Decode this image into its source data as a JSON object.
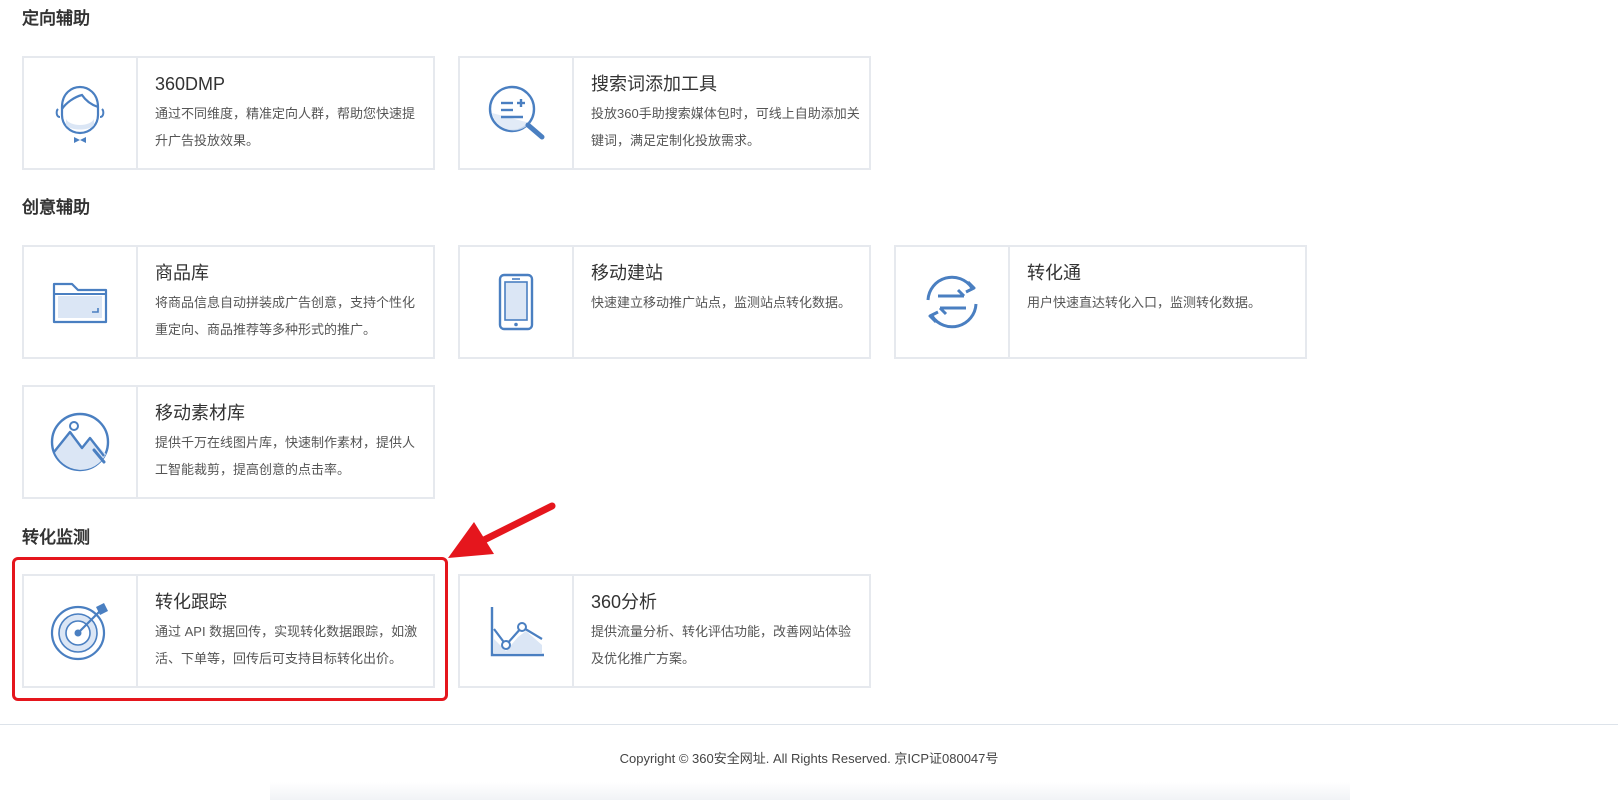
{
  "sections": {
    "targeting": {
      "title": "定向辅助",
      "cards": [
        {
          "title": "360DMP",
          "desc": "通过不同维度，精准定向人群，帮助您快速提升广告投放效果。",
          "icon": "avatar-icon"
        },
        {
          "title": "搜索词添加工具",
          "desc": "投放360手助搜索媒体包时，可线上自助添加关键词，满足定制化投放需求。",
          "icon": "search-list-icon"
        }
      ]
    },
    "creative": {
      "title": "创意辅助",
      "cards": [
        {
          "title": "商品库",
          "desc": "将商品信息自动拼装成广告创意，支持个性化重定向、商品推荐等多种形式的推广。",
          "icon": "folder-icon"
        },
        {
          "title": "移动建站",
          "desc": "快速建立移动推广站点，监测站点转化数据。",
          "icon": "tablet-icon"
        },
        {
          "title": "转化通",
          "desc": "用户快速直达转化入口，监测转化数据。",
          "icon": "exchange-icon"
        },
        {
          "title": "移动素材库",
          "desc": "提供千万在线图片库，快速制作素材，提供人工智能裁剪，提高创意的点击率。",
          "icon": "image-library-icon"
        }
      ]
    },
    "conversion": {
      "title": "转化监测",
      "cards": [
        {
          "title": "转化跟踪",
          "desc": "通过 API 数据回传，实现转化数据跟踪，如激活、下单等，回传后可支持目标转化出价。",
          "icon": "target-icon"
        },
        {
          "title": "360分析",
          "desc": "提供流量分析、转化评估功能，改善网站体验及优化推广方案。",
          "icon": "line-chart-icon"
        }
      ]
    }
  },
  "footer": {
    "copyright": "Copyright © 360安全网址. All Rights Reserved. 京ICP证080047号"
  },
  "colors": {
    "icon_blue": "#4a7fc1",
    "icon_light": "#dbe6f5",
    "border": "#e6e9ee",
    "highlight_red": "#e5161d"
  }
}
